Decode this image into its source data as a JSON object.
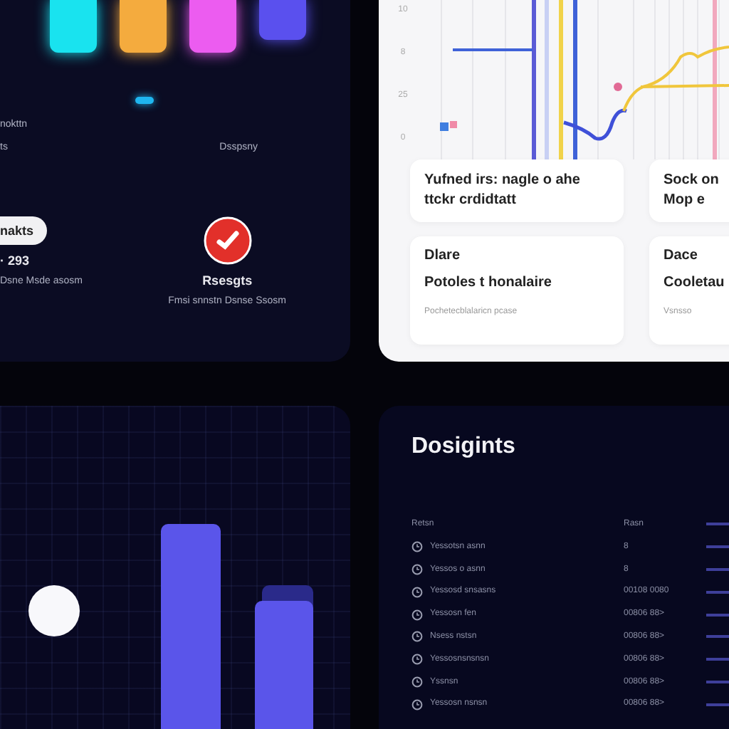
{
  "top_left_panel": {
    "color_bars": [
      {
        "color": "#19e3ef"
      },
      {
        "color": "#f4ab3e"
      },
      {
        "color": "#ec5cf0"
      },
      {
        "color": "#5a50ee"
      }
    ],
    "label_left": "nokttn",
    "label_small": "ts",
    "label_right": "Dsspsny",
    "pill": "nakts",
    "value": "· 293",
    "caption": "Dsne Msde asosm",
    "status_title": "Rsesgts",
    "status_caption": "Fmsi snnstn Dsnse Ssosm"
  },
  "chart_panel": {
    "y_labels": [
      "10",
      "8",
      "25",
      "0"
    ],
    "notes": [
      {
        "lines": [
          "Yufned irs: nagle o ahe",
          "ttckr crdidtatt"
        ]
      },
      {
        "lines": [
          "Sock on",
          "Mop e"
        ]
      }
    ],
    "details": [
      {
        "title": "Dlare",
        "subtitle": "Potoles t honalaire",
        "caption": "Pochetecblalaricn pcase"
      },
      {
        "title": "Dace",
        "subtitle": "Cooletau",
        "caption": "Vsnsso"
      }
    ]
  },
  "list_panel": {
    "title": "Dosigints",
    "columns": [
      "Retsn",
      "Rasn"
    ],
    "rows": [
      {
        "name": "Yessotsn asnn",
        "value": "8"
      },
      {
        "name": "Yessos o asnn",
        "value": "8"
      },
      {
        "name": "Yessosd snsasns",
        "value": "00108 0080"
      },
      {
        "name": "Yessosn fen",
        "value": "00806 88>"
      },
      {
        "name": "Nsess nstsn",
        "value": "00806 88>"
      },
      {
        "name": "Yessosnsnsnsn",
        "value": "00806 88>"
      },
      {
        "name": "Yssnsn",
        "value": "00806 88>"
      },
      {
        "name": "Yessosn nsnsn",
        "value": "00806 88>"
      }
    ]
  }
}
